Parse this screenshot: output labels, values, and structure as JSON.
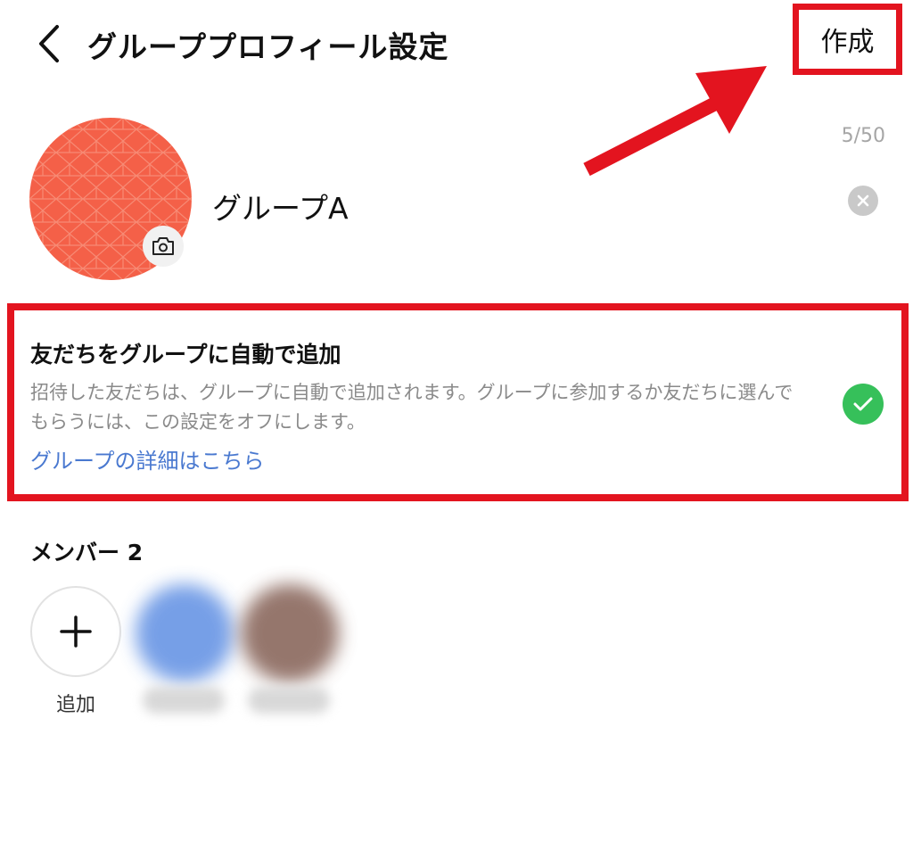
{
  "header": {
    "title": "グループプロフィール設定",
    "create_label": "作成"
  },
  "profile": {
    "name_value": "グループA",
    "char_counter": "5/50",
    "avatar_color": "#f46048"
  },
  "auto_add": {
    "title": "友だちをグループに自動で追加",
    "description": "招待した友だちは、グループに自動で追加されます。グループに参加するか友だちに選んでもらうには、この設定をオフにします。",
    "link_label": "グループの詳細はこちら",
    "enabled": true
  },
  "members": {
    "title": "メンバー 2",
    "add_label": "追加"
  },
  "colors": {
    "annotation_red": "#e3141f",
    "toggle_green": "#36c05a",
    "link_blue": "#4a79d0"
  }
}
